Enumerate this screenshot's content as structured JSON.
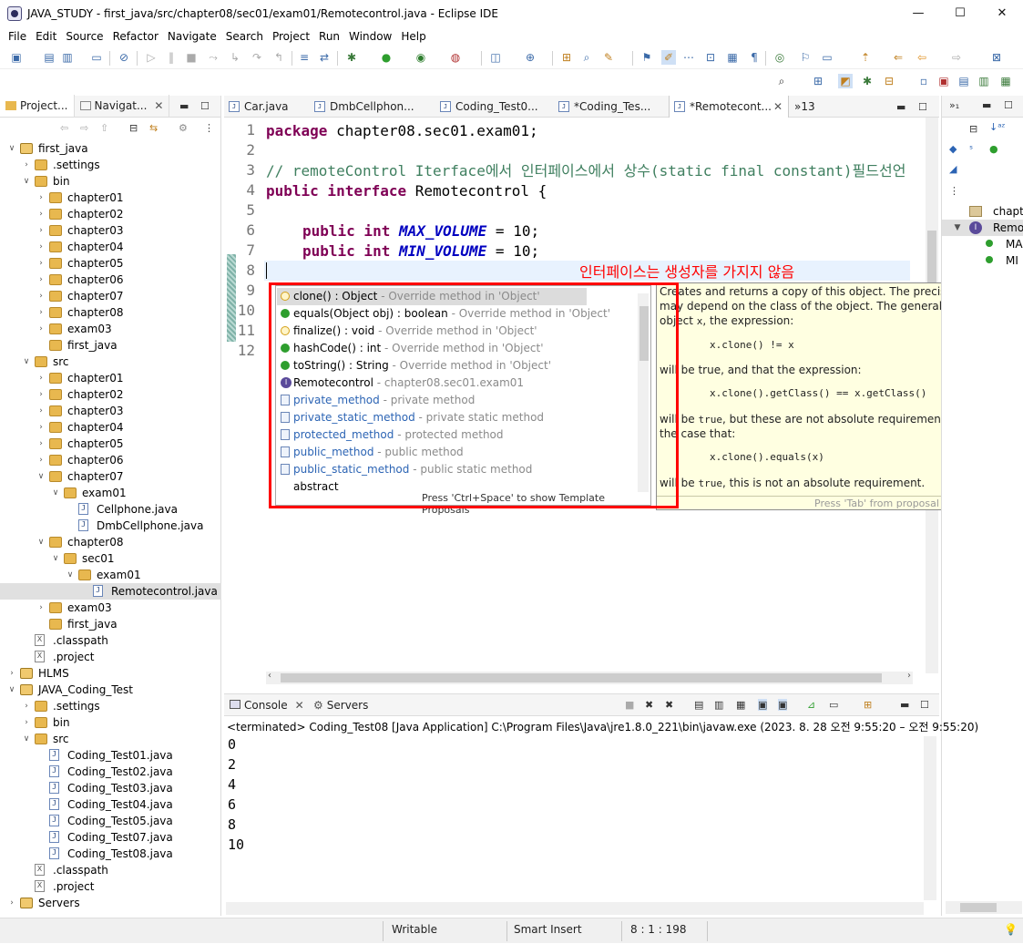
{
  "window": {
    "title": "JAVA_STUDY - first_java/src/chapter08/sec01/exam01/Remotecontrol.java - Eclipse IDE",
    "minimize": "—",
    "maximize": "☐",
    "close": "✕"
  },
  "menu": [
    "File",
    "Edit",
    "Source",
    "Refactor",
    "Navigate",
    "Search",
    "Project",
    "Run",
    "Window",
    "Help"
  ],
  "left_panel": {
    "tabs": [
      {
        "label": "Project..."
      },
      {
        "label": "Navigat..."
      }
    ],
    "tree": [
      {
        "label": "first_java",
        "icon": "project"
      },
      {
        "label": ".settings",
        "icon": "folder"
      },
      {
        "label": "bin",
        "icon": "folder"
      },
      {
        "label": "chapter01",
        "icon": "folder"
      },
      {
        "label": "chapter02",
        "icon": "folder"
      },
      {
        "label": "chapter03",
        "icon": "folder"
      },
      {
        "label": "chapter04",
        "icon": "folder"
      },
      {
        "label": "chapter05",
        "icon": "folder"
      },
      {
        "label": "chapter06",
        "icon": "folder"
      },
      {
        "label": "chapter07",
        "icon": "folder"
      },
      {
        "label": "chapter08",
        "icon": "folder"
      },
      {
        "label": "exam03",
        "icon": "folder"
      },
      {
        "label": "first_java",
        "icon": "folder"
      },
      {
        "label": "src",
        "icon": "folder"
      },
      {
        "label": "chapter01",
        "icon": "folder"
      },
      {
        "label": "chapter02",
        "icon": "folder"
      },
      {
        "label": "chapter03",
        "icon": "folder"
      },
      {
        "label": "chapter04",
        "icon": "folder"
      },
      {
        "label": "chapter05",
        "icon": "folder"
      },
      {
        "label": "chapter06",
        "icon": "folder"
      },
      {
        "label": "chapter07",
        "icon": "folder"
      },
      {
        "label": "exam01",
        "icon": "folder"
      },
      {
        "label": "Cellphone.java",
        "icon": "java"
      },
      {
        "label": "DmbCellphone.java",
        "icon": "java"
      },
      {
        "label": "chapter08",
        "icon": "folder"
      },
      {
        "label": "sec01",
        "icon": "folder"
      },
      {
        "label": "exam01",
        "icon": "folder"
      },
      {
        "label": "Remotecontrol.java",
        "icon": "java",
        "selected": true
      },
      {
        "label": "exam03",
        "icon": "folder"
      },
      {
        "label": "first_java",
        "icon": "folder"
      },
      {
        "label": ".classpath",
        "icon": "xml"
      },
      {
        "label": ".project",
        "icon": "xml"
      },
      {
        "label": "HLMS",
        "icon": "project"
      },
      {
        "label": "JAVA_Coding_Test",
        "icon": "project"
      },
      {
        "label": ".settings",
        "icon": "folder"
      },
      {
        "label": "bin",
        "icon": "folder"
      },
      {
        "label": "src",
        "icon": "folder"
      },
      {
        "label": "Coding_Test01.java",
        "icon": "java"
      },
      {
        "label": "Coding_Test02.java",
        "icon": "java"
      },
      {
        "label": "Coding_Test03.java",
        "icon": "java"
      },
      {
        "label": "Coding_Test04.java",
        "icon": "java"
      },
      {
        "label": "Coding_Test05.java",
        "icon": "java"
      },
      {
        "label": "Coding_Test07.java",
        "icon": "java"
      },
      {
        "label": "Coding_Test08.java",
        "icon": "java"
      },
      {
        "label": ".classpath",
        "icon": "xml"
      },
      {
        "label": ".project",
        "icon": "xml"
      },
      {
        "label": "Servers",
        "icon": "project"
      }
    ]
  },
  "editor": {
    "tabs": [
      {
        "label": "Car.java"
      },
      {
        "label": "DmbCellphon..."
      },
      {
        "label": "Coding_Test0..."
      },
      {
        "label": "*Coding_Tes..."
      },
      {
        "label": "*Remotecont...",
        "active": true
      }
    ],
    "overflow": "»13",
    "line_numbers": [
      "1",
      "2",
      "3",
      "4",
      "5",
      "6",
      "7",
      "8",
      "9",
      "10",
      "11",
      "12"
    ],
    "code": {
      "l1_kw": "package",
      "l1_rest": " chapter08.sec01.exam01;",
      "l3": "// remoteControl Iterface에서 인터페이스에서 상수(static final constant)필드선언",
      "l4_kw": "public interface",
      "l4_rest": " Remotecontrol {",
      "l6_kw": "public int",
      "l6_const": "MAX_VOLUME",
      "l6_rest": " = 10;",
      "l7_kw": "public int",
      "l7_const": "MIN_VOLUME",
      "l7_rest": " = 10;"
    },
    "annotation": "인터페이스는 생성자를 가지지 않음"
  },
  "content_assist": {
    "items": [
      {
        "name": "clone() : Object",
        "detail": " - Override method in 'Object'",
        "selected": true,
        "icon": "protected"
      },
      {
        "name": "equals(Object obj) : boolean",
        "detail": " - Override method in 'Object'",
        "icon": "public"
      },
      {
        "name": "finalize() : void",
        "detail": " - Override method in 'Object'",
        "icon": "protected"
      },
      {
        "name": "hashCode() : int",
        "detail": " - Override method in 'Object'",
        "icon": "public"
      },
      {
        "name": "toString() : String",
        "detail": " - Override method in 'Object'",
        "icon": "public"
      },
      {
        "name": "Remotecontrol",
        "detail": " - chapter08.sec01.exam01",
        "icon": "interface"
      },
      {
        "name": "private_method",
        "detail": " - private method",
        "icon": "template",
        "link": true
      },
      {
        "name": "private_static_method",
        "detail": " - private static method",
        "icon": "template",
        "link": true
      },
      {
        "name": "protected_method",
        "detail": " - protected method",
        "icon": "template",
        "link": true
      },
      {
        "name": "public_method",
        "detail": " - public method",
        "icon": "template",
        "link": true
      },
      {
        "name": "public_static_method",
        "detail": " - public static method",
        "icon": "template",
        "link": true
      },
      {
        "name": "abstract",
        "detail": "",
        "icon": "none"
      }
    ],
    "footer": "Press 'Ctrl+Space' to show Template Proposals"
  },
  "javadoc": {
    "p1a": "Creates and returns a copy of this object. The precise meaning of \"copy\"",
    "p1b": "may depend on the class of the object. The general intent is that, for any",
    "p1c_code": "x",
    "p1c_pre": "object ",
    "p1c_post": ", the expression:",
    "c1": "x.clone() != x",
    "p2": "will be true, and that the expression:",
    "c2": "x.clone().getClass() == x.getClass()",
    "p3a_pre": "will be ",
    "p3a_code": "true",
    "p3a_post": ", but these are not absolute requirements. While it is typically",
    "p3b": "the case that:",
    "c3": "x.clone().equals(x)",
    "p4_pre": "will be ",
    "p4_code": "true",
    "p4_post": ", this is not an absolute requirement.",
    "footer": "Press 'Tab' from proposal table or click for focus"
  },
  "right_panel": {
    "items": [
      {
        "label": "chapt"
      },
      {
        "label": "Remo"
      },
      {
        "label": "MA"
      },
      {
        "label": "MI"
      }
    ]
  },
  "console": {
    "tabs": [
      {
        "label": "Console",
        "active": true
      },
      {
        "label": "Servers"
      }
    ],
    "terminated": "<terminated> Coding_Test08 [Java Application] C:\\Program Files\\Java\\jre1.8.0_221\\bin\\javaw.exe  (2023. 8. 28 오전 9:55:20 – 오전 9:55:20)",
    "output": [
      "0",
      "2",
      "4",
      "6",
      "8",
      "10"
    ]
  },
  "statusbar": {
    "writable": "Writable",
    "insert_mode": "Smart Insert",
    "position": "8 : 1 : 198"
  }
}
